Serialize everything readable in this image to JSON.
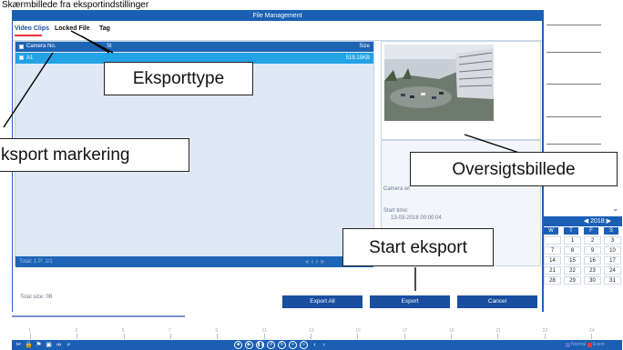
{
  "caption": "Skærmbillede fra eksportindstillinger",
  "window": {
    "title": "File Management"
  },
  "tabs": [
    {
      "label": "Video Clips",
      "active": true
    },
    {
      "label": "Locked File",
      "active": false
    },
    {
      "label": "Tag",
      "active": false
    }
  ],
  "list": {
    "columns": [
      "Camera No.",
      "St",
      "Size"
    ],
    "rows": [
      {
        "camera": "A1",
        "size": "519.15KB"
      }
    ],
    "status": "Total: 1  P: 1/1",
    "pager": "«  ‹  ›  »"
  },
  "info": {
    "camera_label": "Camera wi",
    "start_time_label": "Start time:",
    "start_time_value": "13-03-2018 00:00:04"
  },
  "footer": {
    "total_size": "Total size: 0B"
  },
  "buttons": {
    "export_all": "Export All",
    "export": "Export",
    "cancel": "Cancel"
  },
  "calendar": {
    "year": "2018",
    "weekdays": [
      "W",
      "T",
      "F",
      "S"
    ],
    "weeks": [
      [
        "",
        "1",
        "2",
        "3"
      ],
      [
        "7",
        "8",
        "9",
        "10"
      ],
      [
        "14",
        "15",
        "16",
        "17"
      ],
      [
        "21",
        "22",
        "23",
        "24"
      ],
      [
        "28",
        "29",
        "30",
        "31"
      ]
    ]
  },
  "timeline": {
    "ticks": [
      "1",
      "3",
      "5",
      "7",
      "9",
      "11",
      "13",
      "15",
      "17",
      "19",
      "21",
      "23",
      "24"
    ],
    "legend": [
      "Normal",
      "Event"
    ],
    "colors": {
      "normal": "#5b6fd6",
      "event": "#e03a3a"
    }
  },
  "callouts": {
    "export_type": "Eksporttype",
    "export_marking": "ksport markering",
    "overview_image": "Oversigtsbillede",
    "start_export": "Start eksport"
  },
  "colors": {
    "accent": "#1a5fb4",
    "selected_row": "#22a3e6",
    "panel": "#dfe8f5"
  }
}
